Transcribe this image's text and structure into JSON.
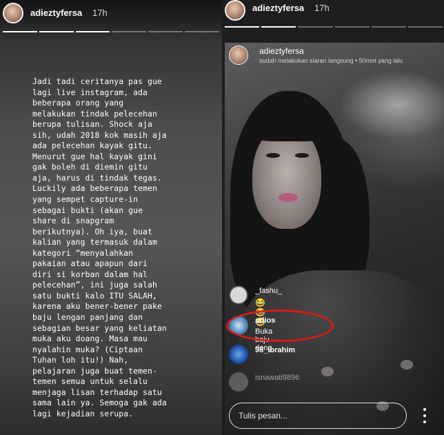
{
  "left_story": {
    "username": "adieztyfersa",
    "time": "17h",
    "text": "Jadi tadi ceritanya pas gue\nlagi live instagram, ada\nbeberapa orang yang\nmelakukan tindak pelecehan\nberupa tulisan. Shock aja\nsih, udah 2018 kok masih aja\nada pelecehan kayak gitu.\nMenurut gue hal kayak gini\ngak boleh di diemin gitu\naja, harus di tindak tegas.\nLuckily ada beberapa temen\nyang sempet capture-in\nsebagai bukti (akan gue\nshare di snapgram\nberikutnya). Oh iya, buat\nkalian yang termasuk dalam\nkategori “menyalahkan\npakaian atau apapun dari\ndiri si korban dalam hal\npelecehan”, ini juga salah\nsatu bukti kalo ITU SALAH,\nkarena aku bener-bener pake\nbaju lengan panjang dan\nsebagian besar yang keliatan\nmuka aku doang. Masa mau\nnyalahin muka? (Ciptaan\nTuhan loh itu!) Nah,\npelajaran juga buat temen-\ntemen semua untuk selalu\nmenjaga lisan terhadap satu\nsama lain ya. Semoga gak ada\nlagi kejadian serupa."
  },
  "right_story": {
    "username": "adieztyfersa",
    "time": "17h",
    "live": {
      "username": "adieztyfersa",
      "subtitle": "sudah melakukan siaran langsung • 50mnt yang lalu"
    },
    "comments": [
      {
        "name": "_fashu_",
        "text": "😂😂😂"
      },
      {
        "name": "arlios",
        "text": "Buka baju dong"
      },
      {
        "name": "98_ibrahim",
        "text": ""
      },
      {
        "name": "isnawati9896",
        "text": ""
      }
    ],
    "input_placeholder": "Tulis pesan..."
  },
  "colors": {
    "highlight": "#d91a1a",
    "text": "#ffffff"
  }
}
